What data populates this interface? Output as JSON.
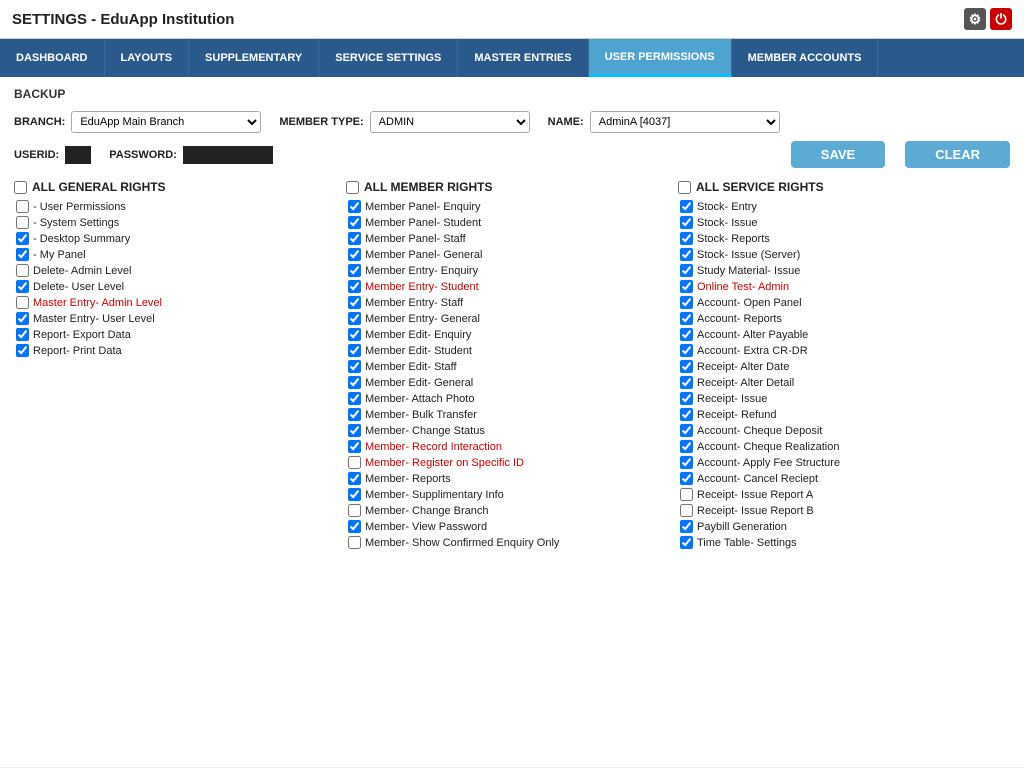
{
  "title": "SETTINGS - EduApp Institution",
  "icons": {
    "gear": "⚙",
    "power": "⏻"
  },
  "nav": {
    "items": [
      {
        "label": "DASHBOARD",
        "active": false
      },
      {
        "label": "LAYOUTS",
        "active": false
      },
      {
        "label": "SUPPLEMENTARY",
        "active": false
      },
      {
        "label": "SERVICE SETTINGS",
        "active": false
      },
      {
        "label": "MASTER ENTRIES",
        "active": false
      },
      {
        "label": "USER PERMISSIONS",
        "active": true
      },
      {
        "label": "MEMBER ACCOUNTS",
        "active": false
      }
    ]
  },
  "backup_label": "BACKUP",
  "fields": {
    "branch_label": "BRANCH:",
    "branch_value": "EduApp Main Branch",
    "member_type_label": "MEMBER TYPE:",
    "member_type_value": "ADMIN",
    "name_label": "NAME:",
    "name_value": "AdminA [4037]",
    "userid_label": "USERID:",
    "password_label": "PASSWORD:"
  },
  "buttons": {
    "save": "SAVE",
    "clear": "CLEAR"
  },
  "general_rights": {
    "header": "ALL GENERAL RIGHTS",
    "items": [
      {
        "label": "- User Permissions",
        "checked": false,
        "highlighted": false
      },
      {
        "label": "- System Settings",
        "checked": false,
        "highlighted": false
      },
      {
        "label": "- Desktop Summary",
        "checked": true,
        "highlighted": false
      },
      {
        "label": "- My Panel",
        "checked": true,
        "highlighted": false
      },
      {
        "label": "Delete- Admin Level",
        "checked": false,
        "highlighted": false
      },
      {
        "label": "Delete- User Level",
        "checked": true,
        "highlighted": false
      },
      {
        "label": "Master Entry- Admin Level",
        "checked": false,
        "highlighted": true
      },
      {
        "label": "Master Entry- User Level",
        "checked": true,
        "highlighted": false
      },
      {
        "label": "Report- Export Data",
        "checked": true,
        "highlighted": false
      },
      {
        "label": "Report- Print Data",
        "checked": true,
        "highlighted": false
      }
    ]
  },
  "member_rights": {
    "header": "ALL MEMBER RIGHTS",
    "items": [
      {
        "label": "Member Panel- Enquiry",
        "checked": true,
        "highlighted": false
      },
      {
        "label": "Member Panel- Student",
        "checked": true,
        "highlighted": false
      },
      {
        "label": "Member Panel- Staff",
        "checked": true,
        "highlighted": false
      },
      {
        "label": "Member Panel- General",
        "checked": true,
        "highlighted": false
      },
      {
        "label": "Member Entry- Enquiry",
        "checked": true,
        "highlighted": false
      },
      {
        "label": "Member Entry- Student",
        "checked": true,
        "highlighted": true
      },
      {
        "label": "Member Entry- Staff",
        "checked": true,
        "highlighted": false
      },
      {
        "label": "Member Entry- General",
        "checked": true,
        "highlighted": false
      },
      {
        "label": "Member Edit- Enquiry",
        "checked": true,
        "highlighted": false
      },
      {
        "label": "Member Edit- Student",
        "checked": true,
        "highlighted": false
      },
      {
        "label": "Member Edit- Staff",
        "checked": true,
        "highlighted": false
      },
      {
        "label": "Member Edit- General",
        "checked": true,
        "highlighted": false
      },
      {
        "label": "Member- Attach Photo",
        "checked": true,
        "highlighted": false
      },
      {
        "label": "Member- Bulk Transfer",
        "checked": true,
        "highlighted": false
      },
      {
        "label": "Member- Change Status",
        "checked": true,
        "highlighted": false
      },
      {
        "label": "Member- Record Interaction",
        "checked": true,
        "highlighted": true
      },
      {
        "label": "Member- Register on Specific ID",
        "checked": false,
        "highlighted": true
      },
      {
        "label": "Member- Reports",
        "checked": true,
        "highlighted": false
      },
      {
        "label": "Member- Supplimentary Info",
        "checked": true,
        "highlighted": false
      },
      {
        "label": "Member- Change Branch",
        "checked": false,
        "highlighted": false
      },
      {
        "label": "Member- View Password",
        "checked": true,
        "highlighted": false
      },
      {
        "label": "Member- Show Confirmed Enquiry Only",
        "checked": false,
        "highlighted": false
      }
    ]
  },
  "service_rights": {
    "header": "ALL SERVICE RIGHTS",
    "items": [
      {
        "label": "Stock- Entry",
        "checked": true,
        "highlighted": false
      },
      {
        "label": "Stock- Issue",
        "checked": true,
        "highlighted": false
      },
      {
        "label": "Stock- Reports",
        "checked": true,
        "highlighted": false
      },
      {
        "label": "Stock- Issue (Server)",
        "checked": true,
        "highlighted": false
      },
      {
        "label": "Study Material- Issue",
        "checked": true,
        "highlighted": false
      },
      {
        "label": "Online Test- Admin",
        "checked": true,
        "highlighted": true
      },
      {
        "label": "Account- Open Panel",
        "checked": true,
        "highlighted": false
      },
      {
        "label": "Account- Reports",
        "checked": true,
        "highlighted": false
      },
      {
        "label": "Account- Alter Payable",
        "checked": true,
        "highlighted": false
      },
      {
        "label": "Account- Extra CR-DR",
        "checked": true,
        "highlighted": false
      },
      {
        "label": "Receipt- Alter Date",
        "checked": true,
        "highlighted": false
      },
      {
        "label": "Receipt- Alter Detail",
        "checked": true,
        "highlighted": false
      },
      {
        "label": "Receipt- Issue",
        "checked": true,
        "highlighted": false
      },
      {
        "label": "Receipt- Refund",
        "checked": true,
        "highlighted": false
      },
      {
        "label": "Account- Cheque Deposit",
        "checked": true,
        "highlighted": false
      },
      {
        "label": "Account- Cheque Realization",
        "checked": true,
        "highlighted": false
      },
      {
        "label": "Account- Apply Fee Structure",
        "checked": true,
        "highlighted": false
      },
      {
        "label": "Account- Cancel Reciept",
        "checked": true,
        "highlighted": false
      },
      {
        "label": "Receipt- Issue Report A",
        "checked": false,
        "highlighted": false
      },
      {
        "label": "Receipt- Issue Report B",
        "checked": false,
        "highlighted": false
      },
      {
        "label": "Paybill Generation",
        "checked": true,
        "highlighted": false
      },
      {
        "label": "Time Table- Settings",
        "checked": true,
        "highlighted": false
      }
    ]
  }
}
